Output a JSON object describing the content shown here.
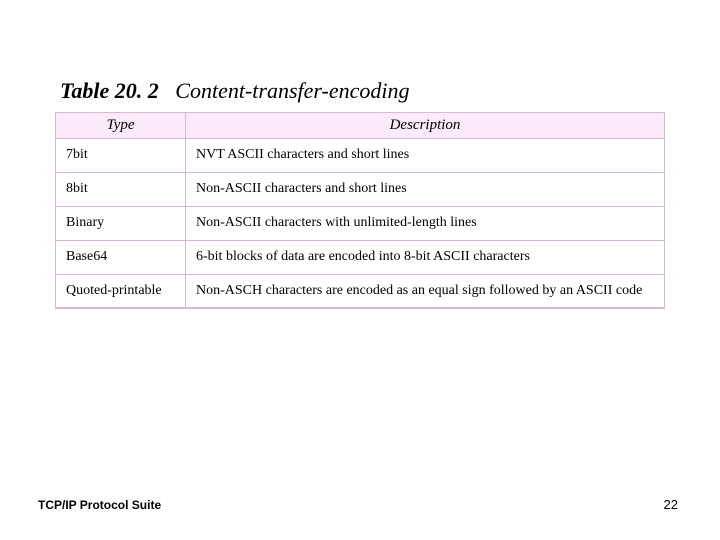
{
  "title": {
    "number": "Table 20. 2",
    "text": "Content-transfer-encoding"
  },
  "table": {
    "headers": {
      "type": "Type",
      "description": "Description"
    },
    "rows": [
      {
        "type": "7bit",
        "description": "NVT ASCII characters and short lines"
      },
      {
        "type": "8bit",
        "description": "Non-ASCII characters and short lines"
      },
      {
        "type": "Binary",
        "description": "Non-ASCII characters with unlimited-length lines"
      },
      {
        "type": "Base64",
        "description": "6-bit blocks of data are encoded into 8-bit ASCII characters"
      },
      {
        "type": "Quoted-printable",
        "description": "Non-ASCH characters are encoded as an equal sign followed by an ASCII code"
      }
    ]
  },
  "footer": {
    "left": "TCP/IP Protocol Suite",
    "page": "22"
  }
}
